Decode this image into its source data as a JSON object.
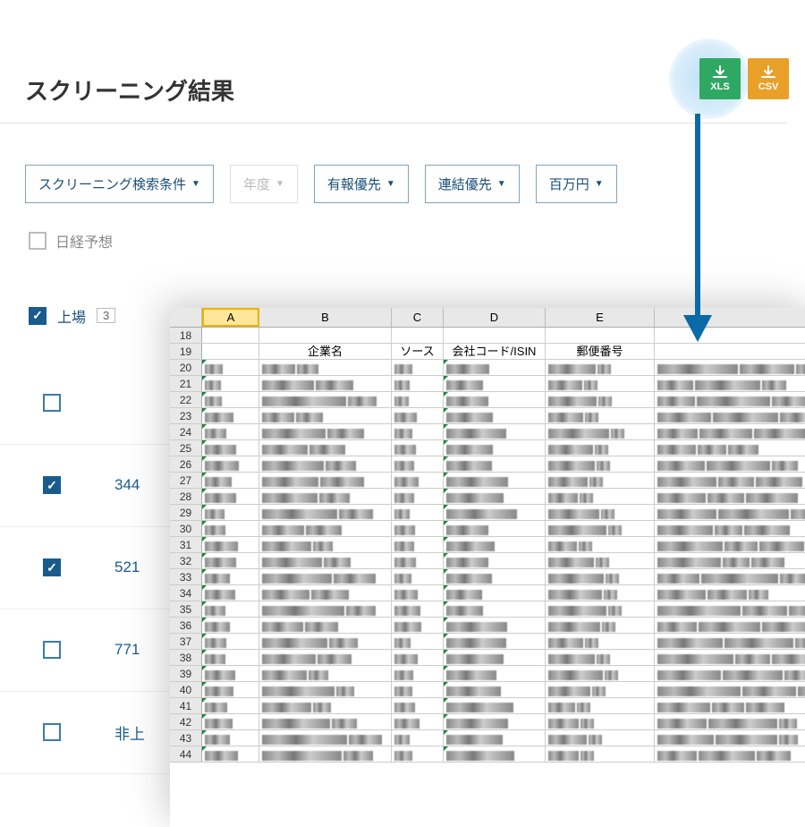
{
  "page_title": "スクリーニング結果",
  "export": {
    "xls": "XLS",
    "csv": "CSV"
  },
  "filters": {
    "conditions": "スクリーニング検索条件",
    "year": "年度",
    "report_priority": "有報優先",
    "consolidated_priority": "連結優先",
    "unit": "百万円"
  },
  "nikkei_forecast": "日経予想",
  "listed_header": {
    "label": "上場",
    "count": "3"
  },
  "results": [
    {
      "checked": false,
      "id": ""
    },
    {
      "checked": true,
      "id": "344"
    },
    {
      "checked": true,
      "id": "521"
    },
    {
      "checked": false,
      "id": "771"
    },
    {
      "checked": false,
      "id": "非上"
    }
  ],
  "excel": {
    "columns": [
      "A",
      "B",
      "C",
      "D",
      "E"
    ],
    "header_row": 19,
    "headers": {
      "B": "企業名",
      "C": "ソース",
      "D": "会社コード/ISIN",
      "E": "郵便番号"
    },
    "first_data_row": 20,
    "data_row_count": 25,
    "pre_row": 18
  }
}
